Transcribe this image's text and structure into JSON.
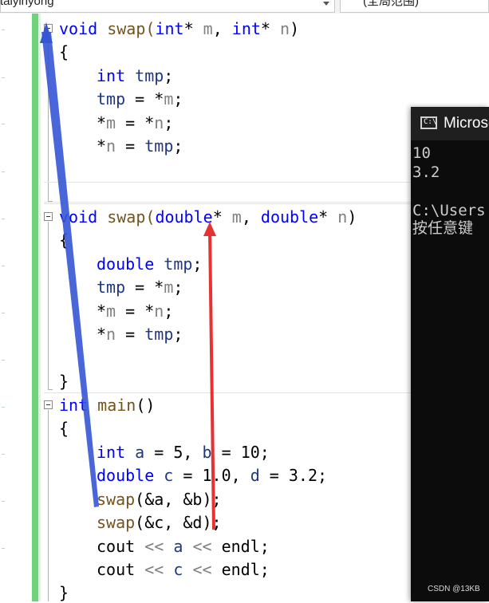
{
  "toolbar": {
    "scope_dropdown": "taiyinyong",
    "member_dropdown": "(全局范围)"
  },
  "code": {
    "swap_int": {
      "signature": {
        "ret": "void",
        "name": "swap",
        "open": "(",
        "type1": "int",
        "star1": "*",
        "p1": "m",
        "comma": ",",
        "type2": "int",
        "star2": "*",
        "p2": "n",
        "close": ")"
      },
      "open_brace": "{",
      "l1": {
        "type": "int",
        "var": "tmp",
        "end": ";"
      },
      "l2": {
        "lhs": "tmp",
        "op": "=",
        "star": "*",
        "rhs": "m",
        "end": ";"
      },
      "l3": {
        "star": "*",
        "lhs": "m",
        "op": "=",
        "star2": "*",
        "rhs": "n",
        "end": ";"
      },
      "l4": {
        "star": "*",
        "lhs": "n",
        "op": "=",
        "rhs": "tmp",
        "end": ";"
      }
    },
    "swap_double": {
      "signature": {
        "ret": "void",
        "name": "swap",
        "open": "(",
        "type1": "double",
        "star1": "*",
        "p1": "m",
        "comma": ",",
        "type2": "double",
        "star2": "*",
        "p2": "n",
        "close": ")"
      },
      "open_brace": "{",
      "l1": {
        "type": "double",
        "var": "tmp",
        "end": ";"
      },
      "l2": {
        "lhs": "tmp",
        "op": "=",
        "star": "*",
        "rhs": "m",
        "end": ";"
      },
      "l3": {
        "star": "*",
        "lhs": "m",
        "op": "=",
        "star2": "*",
        "rhs": "n",
        "end": ";"
      },
      "l4": {
        "star": "*",
        "lhs": "n",
        "op": "=",
        "rhs": "tmp",
        "end": ";"
      },
      "close_brace": "}"
    },
    "main": {
      "signature": {
        "ret": "int",
        "name": "main",
        "parens": "()"
      },
      "open_brace": "{",
      "l1": {
        "type": "int",
        "a": "a",
        "eq1": "=",
        "v1": "5",
        "comma": ",",
        "b": "b",
        "eq2": "=",
        "v2": "10",
        "end": ";"
      },
      "l2": {
        "type": "double",
        "c": "c",
        "eq1": "=",
        "v1": "1.0",
        "comma": ",",
        "d": "d",
        "eq2": "=",
        "v2": "3.2",
        "end": ";"
      },
      "l3": {
        "fn": "swap",
        "args": "(&a, &b)",
        "end": ";"
      },
      "l4": {
        "fn": "swap",
        "args": "(&c, &d)",
        "end": ";"
      },
      "l5": {
        "obj": "cout",
        "op1": "<<",
        "var": "a",
        "op2": "<<",
        "endl": "endl",
        "end": ";"
      },
      "l6": {
        "obj": "cout",
        "op1": "<<",
        "var": "c",
        "op2": "<<",
        "endl": "endl",
        "end": ";"
      },
      "close_brace": "}"
    }
  },
  "console": {
    "title": "Microsoft Visual Studio 调试控制台",
    "icon_text": "C:\\",
    "lines": [
      "10",
      "3.2",
      "",
      "C:\\Users",
      "按任意键"
    ]
  },
  "watermark": "CSDN @13KB",
  "colors": {
    "keyword": "#0000ff",
    "function": "#74531f",
    "parameter": "#808080",
    "local_variable": "#1f377f",
    "change_bar": "#6fd479",
    "blue_arrow": "#3557d4",
    "red_arrow": "#e63232"
  }
}
